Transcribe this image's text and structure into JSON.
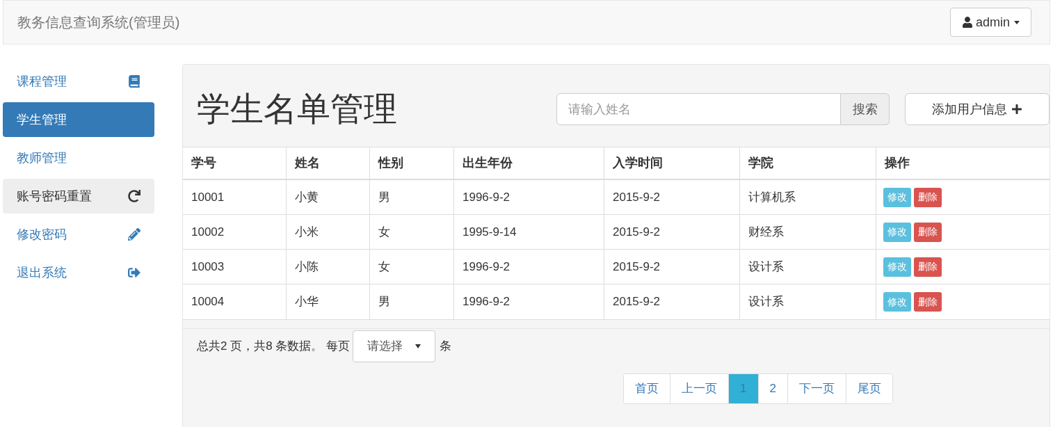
{
  "navbar": {
    "brand": "教务信息查询系统(管理员)",
    "user_menu": "admin"
  },
  "sidebar": {
    "items": [
      {
        "label": "课程管理",
        "selected": false,
        "hovered": false
      },
      {
        "label": "学生管理",
        "selected": true,
        "hovered": false
      },
      {
        "label": "教师管理",
        "selected": false,
        "hovered": false
      },
      {
        "label": "账号密码重置",
        "selected": false,
        "hovered": true
      },
      {
        "label": "修改密码",
        "selected": false,
        "hovered": false
      },
      {
        "label": "退出系统",
        "selected": false,
        "hovered": false
      }
    ]
  },
  "page": {
    "title": "学生名单管理",
    "search": {
      "placeholder": "请输入姓名",
      "button": "搜索"
    },
    "add_button": "添加用户信息"
  },
  "table": {
    "columns": [
      "学号",
      "姓名",
      "性别",
      "出生年份",
      "入学时间",
      "学院",
      "操作"
    ],
    "rows": [
      {
        "cells": [
          "10001",
          "小黄",
          "男",
          "1996-9-2",
          "2015-9-2",
          "计算机系"
        ],
        "actions": [
          "修改",
          "删除"
        ]
      },
      {
        "cells": [
          "10002",
          "小米",
          "女",
          "1995-9-14",
          "2015-9-2",
          "财经系"
        ],
        "actions": [
          "修改",
          "删除"
        ]
      },
      {
        "cells": [
          "10003",
          "小陈",
          "女",
          "1996-9-2",
          "2015-9-2",
          "设计系"
        ],
        "actions": [
          "修改",
          "删除"
        ]
      },
      {
        "cells": [
          "10004",
          "小华",
          "男",
          "1996-9-2",
          "2015-9-2",
          "设计系"
        ],
        "actions": [
          "修改",
          "删除"
        ]
      }
    ]
  },
  "footer": {
    "summary": "总共2 页，共8 条数据。 每页",
    "page_size_select": "请选择",
    "unit": "条"
  },
  "pagination": [
    {
      "label": "首页",
      "selected": false
    },
    {
      "label": "上一页",
      "selected": false
    },
    {
      "label": "1",
      "selected": true
    },
    {
      "label": "2",
      "selected": false
    },
    {
      "label": "下一页",
      "selected": false
    },
    {
      "label": "尾页",
      "selected": false
    }
  ]
}
